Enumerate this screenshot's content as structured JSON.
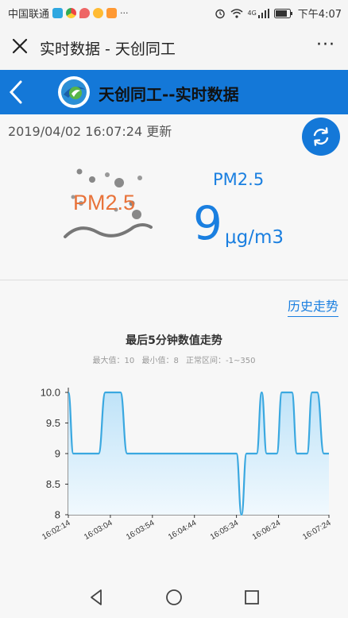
{
  "status_bar": {
    "carrier": "中国联通",
    "time": "下午4:07",
    "network": "4G",
    "more_apps": "···"
  },
  "titlebar": {
    "title": "实时数据 - 天创同工",
    "more": "···"
  },
  "header": {
    "title": "天创同工--实时数据",
    "brand_color": "#1478d8"
  },
  "main": {
    "updated": "2019/04/02 16:07:24 更新",
    "pm_graphic_label": "PM2.5",
    "metric_name": "PM2.5",
    "metric_value": "9",
    "metric_unit": "μg/m3",
    "history_link": "历史走势"
  },
  "chart_data": {
    "type": "area",
    "title": "最后5分钟数值走势",
    "subtitle": {
      "max": "最大值：10",
      "min": "最小值：8",
      "range": "正常区间：-1~350"
    },
    "ylim": [
      8,
      10
    ],
    "y_ticks": [
      "10.0",
      "9.5",
      "9",
      "8.5",
      "8"
    ],
    "x_tick_labels": [
      "16:02:14",
      "16:03:04",
      "16:03:54",
      "16:04:44",
      "16:05:34",
      "16:06:24",
      "16:07:24"
    ],
    "x_start": "16:02:14",
    "x_end": "16:07:24",
    "points": [
      [
        "16:02:14",
        10
      ],
      [
        "16:02:20",
        9
      ],
      [
        "16:02:50",
        9
      ],
      [
        "16:02:58",
        10
      ],
      [
        "16:03:16",
        10
      ],
      [
        "16:03:24",
        9
      ],
      [
        "16:05:34",
        9
      ],
      [
        "16:05:40",
        8
      ],
      [
        "16:05:46",
        9
      ],
      [
        "16:05:58",
        9
      ],
      [
        "16:06:04",
        10
      ],
      [
        "16:06:10",
        9
      ],
      [
        "16:06:22",
        9
      ],
      [
        "16:06:28",
        10
      ],
      [
        "16:06:40",
        10
      ],
      [
        "16:06:46",
        9
      ],
      [
        "16:06:58",
        9
      ],
      [
        "16:07:04",
        10
      ],
      [
        "16:07:10",
        10
      ],
      [
        "16:07:18",
        9
      ],
      [
        "16:07:24",
        9
      ]
    ],
    "line_color": "#3aa8e0",
    "fill_color": "#cfeaf9"
  },
  "navbar": {
    "back": "back-triangle",
    "home": "home-circle",
    "recent": "recent-square"
  }
}
